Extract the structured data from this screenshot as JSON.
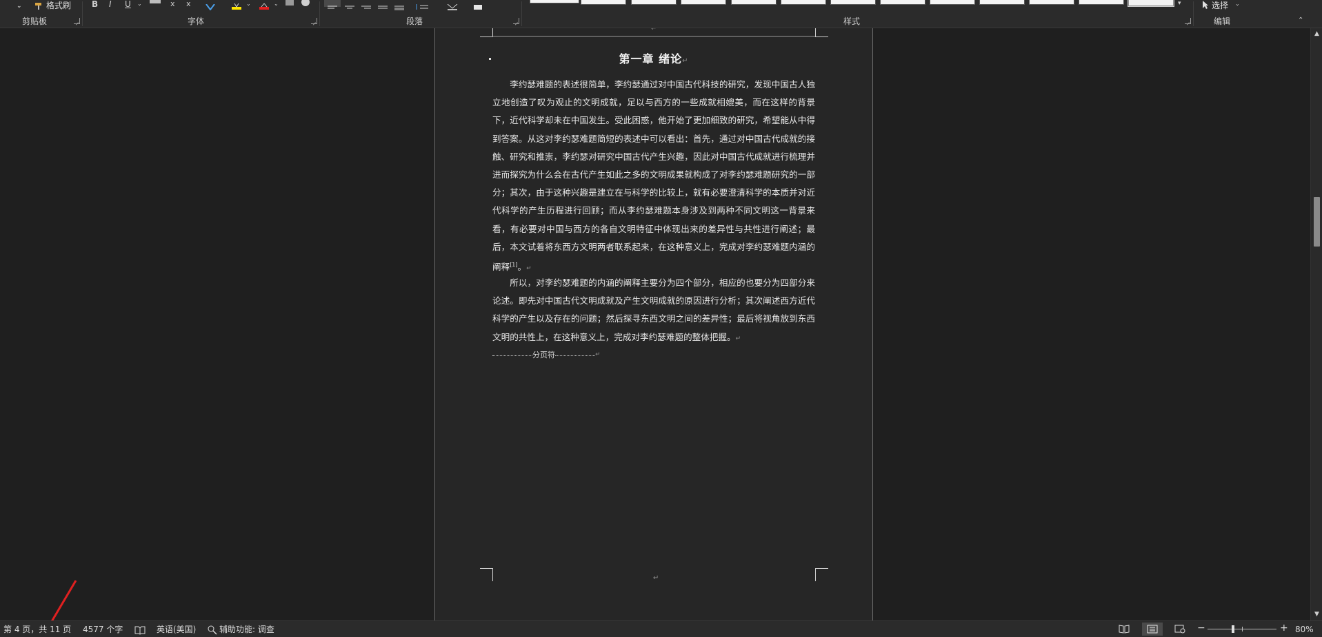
{
  "ribbon": {
    "format_painter_label": "格式刷",
    "groups": {
      "clipboard": "剪贴板",
      "font": "字体",
      "paragraph": "段落",
      "styles": "样式",
      "editing": "编辑"
    },
    "select_label": "选择"
  },
  "document": {
    "chapter_title": "第一章 绪论",
    "paragraph_1": "李约瑟难题的表述很简单，李约瑟通过对中国古代科技的研究，发现中国古人独立地创造了叹为观止的文明成就，足以与西方的一些成就相媲美，而在这样的背景下，近代科学却未在中国发生。受此困惑，他开始了更加细致的研究，希望能从中得到答案。从这对李约瑟难题简短的表述中可以看出：首先，通过对中国古代成就的接触、研究和推崇，李约瑟对研究中国古代产生兴趣，因此对中国古代成就进行梳理并进而探究为什么会在古代产生如此之多的文明成果就构成了对李约瑟难题研究的一部分；其次，由于这种兴趣是建立在与科学的比较上，就有必要澄清科学的本质并对近代科学的产生历程进行回顾；而从李约瑟难题本身涉及到两种不同文明这一背景来看，有必要对中国与西方的各自文明特征中体现出来的差异性与共性进行阐述；最后，本文试着将东西方文明两者联系起来，在这种意义上，完成对李约瑟难题内涵的阐释",
    "paragraph_1_citation": "[1]",
    "paragraph_1_end": "。",
    "paragraph_2": "所以，对李约瑟难题的内涵的阐释主要分为四个部分，相应的也要分为四部分来论述。即先对中国古代文明成就及产生文明成就的原因进行分析；其次阐述西方近代科学的产生以及存在的问题；然后探寻东西文明之间的差异性；最后将视角放到东西文明的共性上，在这种意义上，完成对李约瑟难题的整体把握。",
    "page_break_label": "分页符",
    "paragraph_mark": "↵"
  },
  "status_bar": {
    "page_info": "第 4 页，共 11 页",
    "word_count": "4577 个字",
    "language": "英语(美国)",
    "accessibility": "辅助功能: 调查",
    "zoom": "80%",
    "zoom_minus": "−",
    "zoom_plus": "+"
  },
  "colors": {
    "annotation_arrow": "#e02020",
    "page_bg": "#262626",
    "app_bg": "#1f1f1f"
  }
}
